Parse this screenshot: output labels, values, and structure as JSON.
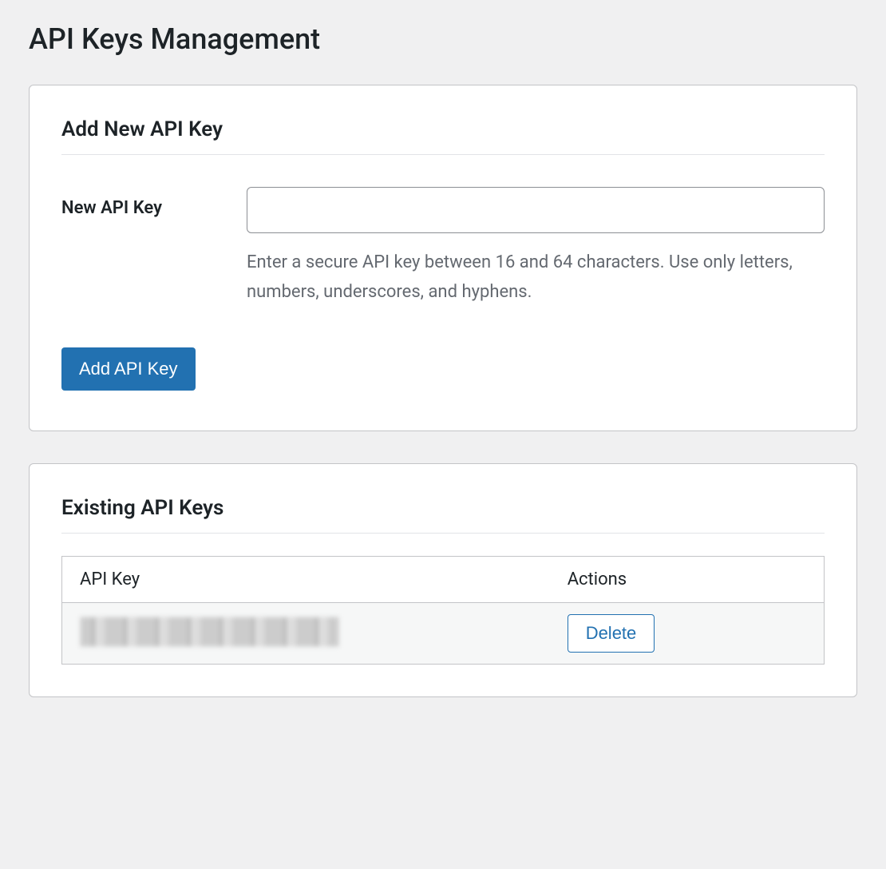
{
  "page": {
    "title": "API Keys Management"
  },
  "add_card": {
    "title": "Add New API Key",
    "field_label": "New API Key",
    "input_value": "",
    "help_text": "Enter a secure API key between 16 and 64 characters. Use only letters, numbers, underscores, and hyphens.",
    "submit_label": "Add API Key"
  },
  "existing_card": {
    "title": "Existing API Keys",
    "columns": {
      "key": "API Key",
      "actions": "Actions"
    },
    "rows": [
      {
        "key_display": "[redacted]",
        "delete_label": "Delete"
      }
    ]
  }
}
